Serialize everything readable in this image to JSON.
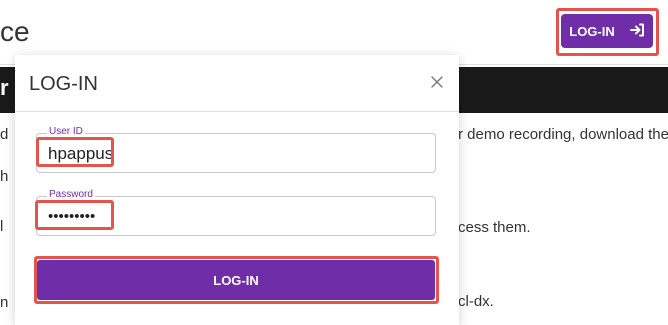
{
  "page": {
    "title_fragment": "ce",
    "dark_bar_fragment": "r",
    "login_button_label": "LOG-IN",
    "text_lines": [
      {
        "left": "d",
        "right": "r demo recording, download the la"
      },
      {
        "left": "h",
        "right": ""
      },
      {
        "left": "l",
        "right": "cess them."
      },
      {
        "left": "n",
        "right": "cl-dx."
      }
    ]
  },
  "modal": {
    "title": "LOG-IN",
    "user_id_label": "User ID",
    "user_id_value": "hpappus",
    "password_label": "Password",
    "password_value": "•••••••••",
    "submit_label": "LOG-IN"
  },
  "icons": {
    "login": "login-arrow-icon",
    "close": "close-icon"
  },
  "colors": {
    "brand_purple": "#6f2da8",
    "highlight_red": "#e4544f",
    "dark_bar": "#1a1a1a"
  }
}
